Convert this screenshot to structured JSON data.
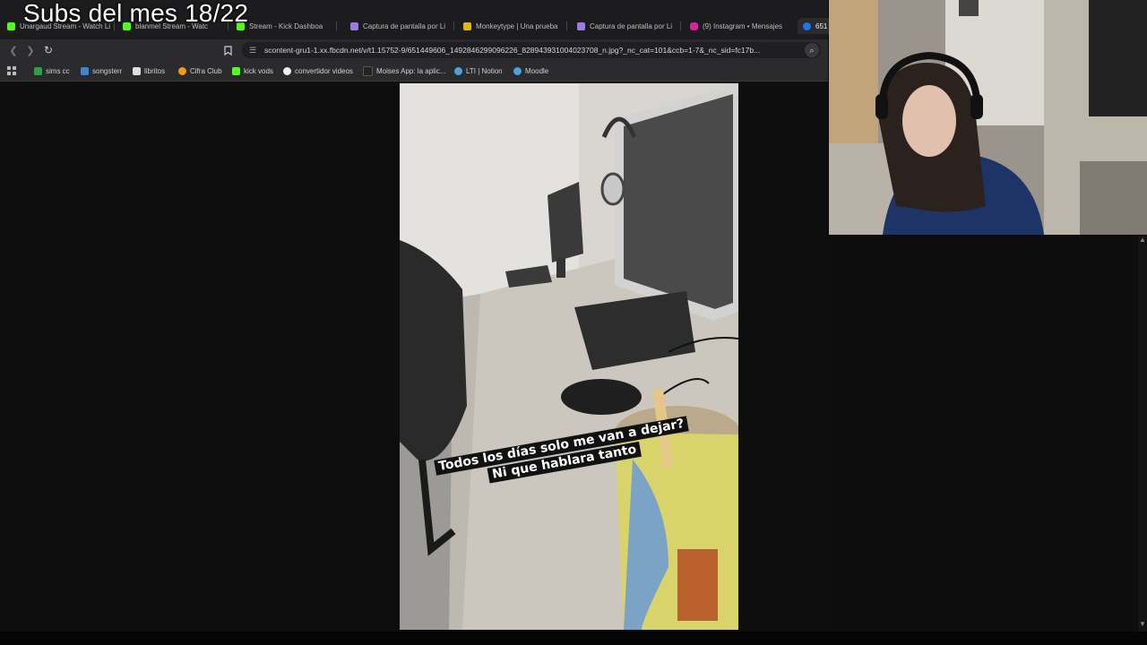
{
  "overlay": {
    "title": "Subs del mes 18/22"
  },
  "tabs": [
    {
      "label": "Unargaud Stream - Watch Li",
      "favicon_color": "#53fc18"
    },
    {
      "label": "blanmel Stream - Watc",
      "favicon_color": "#53fc18"
    },
    {
      "label": "Stream - Kick Dashboa",
      "favicon_color": "#53fc18"
    },
    {
      "label": "Captura de pantalla por Li",
      "favicon_color": "#9b7be0"
    },
    {
      "label": "Monkeytype | Una prueba",
      "favicon_color": "#e2b714"
    },
    {
      "label": "Captura de pantalla por Li",
      "favicon_color": "#9b7be0"
    },
    {
      "label": "(9) Instagram • Mensajes",
      "favicon_color": "#d6249f"
    },
    {
      "label": "651",
      "favicon_color": "#1877f2"
    }
  ],
  "toolbar": {
    "url": "scontent-gru1-1.xx.fbcdn.net/v/t1.15752-9/651449606_1492846299096226_828943931004023708_n.jpg?_nc_cat=101&ccb=1-7&_nc_sid=fc17b..."
  },
  "bookmarks": [
    {
      "label": "sims cc",
      "icon_color": "#2e9d4c"
    },
    {
      "label": "songsterr",
      "icon_color": "#3a86d4"
    },
    {
      "label": "libritos",
      "icon_color": "#dddddd"
    },
    {
      "label": "Cifra Club",
      "icon_color": "#f29a1a"
    },
    {
      "label": "kick vods",
      "icon_color": "#53fc18"
    },
    {
      "label": "convertidor videos",
      "icon_color": "#eeeeee"
    },
    {
      "label": "Moises App: la aplic...",
      "icon_color": "#222222"
    },
    {
      "label": "LTI | Notion",
      "icon_color": "#4aa3df"
    },
    {
      "label": "Moodle",
      "icon_color": "#4aa3df"
    }
  ],
  "photo": {
    "caption_lines": [
      "Todos los días solo me van a dejar?",
      "Ni que hablara tanto"
    ]
  }
}
